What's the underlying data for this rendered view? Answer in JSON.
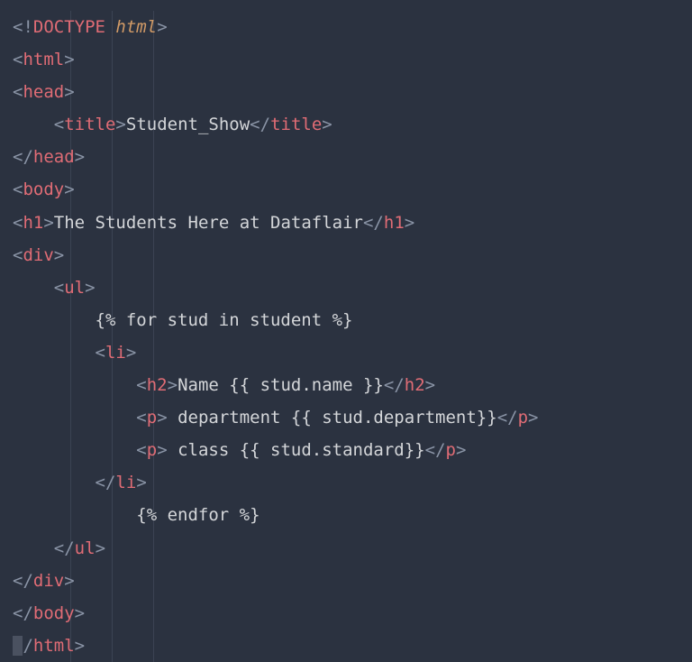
{
  "code": {
    "doctype_open": "<!",
    "doctype_word": "DOCTYPE",
    "doctype_attr": "html",
    "doctype_close": ">",
    "html_open": "<",
    "html_tag": "html",
    "close_slash": "/",
    "gt": ">",
    "lt": "<",
    "head_tag": "head",
    "title_tag": "title",
    "title_text": "Student_Show",
    "body_tag": "body",
    "h1_tag": "h1",
    "h1_text": "The Students Here at Dataflair",
    "div_tag": "div",
    "ul_tag": "ul",
    "for_stmt": "{% for stud in student %}",
    "li_tag": "li",
    "h2_tag": "h2",
    "h2_text": "Name {{ stud.name }}",
    "p_tag": "p",
    "p1_text": " department {{ stud.department}}",
    "p2_text": " class {{ stud.standard}}",
    "endfor_stmt": "{% endfor %}"
  }
}
